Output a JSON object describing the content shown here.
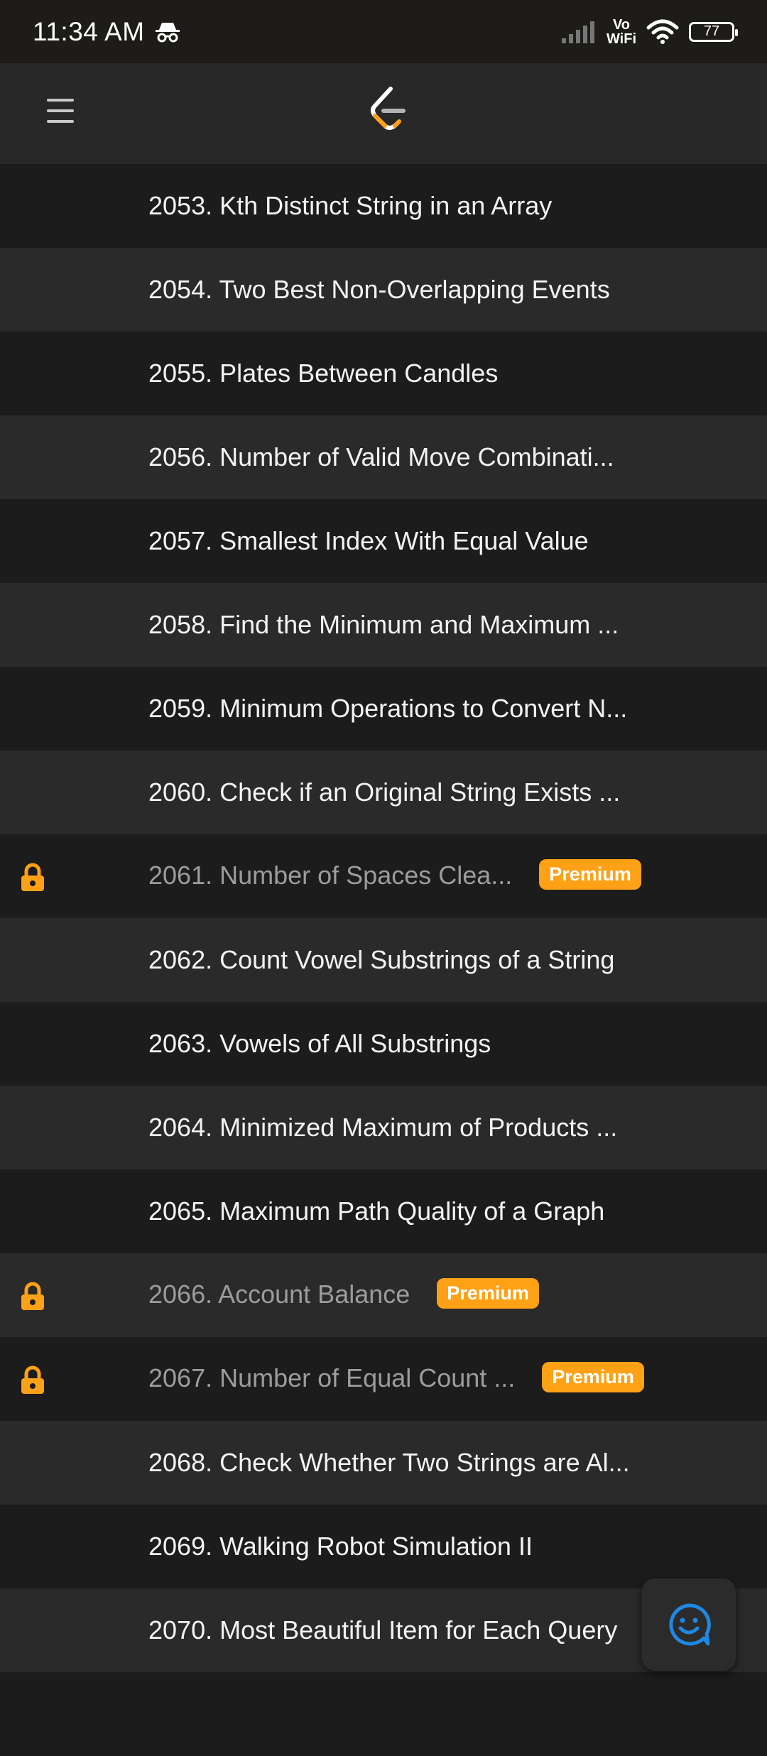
{
  "status_bar": {
    "time": "11:34 AM",
    "vowifi_top": "Vo",
    "vowifi_bottom": "WiFi",
    "battery": "77",
    "icons": [
      "incognito-icon",
      "signal-icon",
      "wifi-icon",
      "battery-icon"
    ]
  },
  "app_bar": {
    "menu_icon": "hamburger-menu-icon",
    "logo_icon": "leetcode-logo-icon"
  },
  "colors": {
    "accent": "#ffa116",
    "fab_icon": "#1e88e5"
  },
  "problems": [
    {
      "title": "2053. Kth Distinct String in an Array",
      "locked": false
    },
    {
      "title": "2054. Two Best Non-Overlapping Events",
      "locked": false
    },
    {
      "title": "2055. Plates Between Candles",
      "locked": false
    },
    {
      "title": "2056. Number of Valid Move Combinati...",
      "locked": false
    },
    {
      "title": "2057. Smallest Index With Equal Value",
      "locked": false
    },
    {
      "title": "2058. Find the Minimum and Maximum ...",
      "locked": false
    },
    {
      "title": "2059. Minimum Operations to Convert N...",
      "locked": false
    },
    {
      "title": "2060. Check if an Original String Exists ...",
      "locked": false
    },
    {
      "title": "2061. Number of Spaces Clea...",
      "locked": true,
      "badge": "Premium"
    },
    {
      "title": "2062. Count Vowel Substrings of a String",
      "locked": false
    },
    {
      "title": "2063. Vowels of All Substrings",
      "locked": false
    },
    {
      "title": "2064. Minimized Maximum of Products ...",
      "locked": false
    },
    {
      "title": "2065. Maximum Path Quality of a Graph",
      "locked": false
    },
    {
      "title": "2066. Account Balance",
      "locked": true,
      "badge": "Premium"
    },
    {
      "title": "2067. Number of Equal Count ...",
      "locked": true,
      "badge": "Premium"
    },
    {
      "title": "2068. Check Whether Two Strings are Al...",
      "locked": false
    },
    {
      "title": "2069. Walking Robot Simulation II",
      "locked": false
    },
    {
      "title": "2070. Most Beautiful Item for Each Query",
      "locked": false
    },
    {
      "title": "",
      "locked": false
    }
  ],
  "fab": {
    "icon": "feedback-smiley-icon"
  }
}
